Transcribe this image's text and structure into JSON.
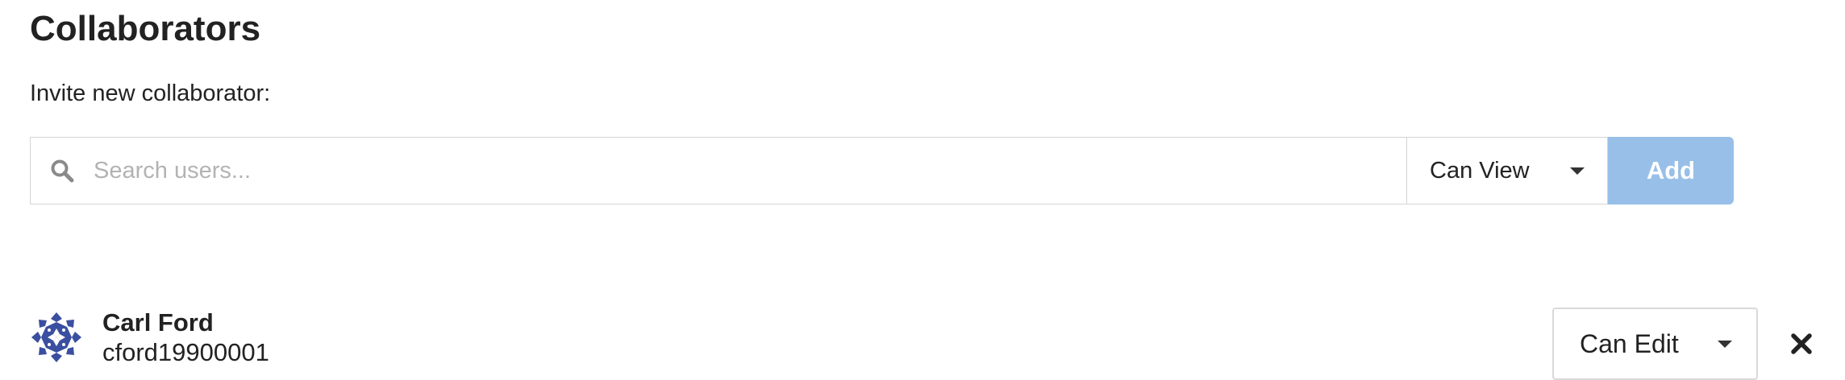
{
  "header": {
    "title": "Collaborators"
  },
  "invite": {
    "label": "Invite new collaborator:",
    "search_placeholder": "Search users...",
    "search_value": "",
    "search_icon": "search-icon",
    "permission_selected": "Can View",
    "add_label": "Add",
    "add_color": "#98bfe8"
  },
  "collaborators": [
    {
      "name": "Carl Ford",
      "username": "cford19900001",
      "permission": "Can Edit",
      "avatar_color": "#3b4fa0",
      "remove_icon": "close-icon"
    }
  ]
}
